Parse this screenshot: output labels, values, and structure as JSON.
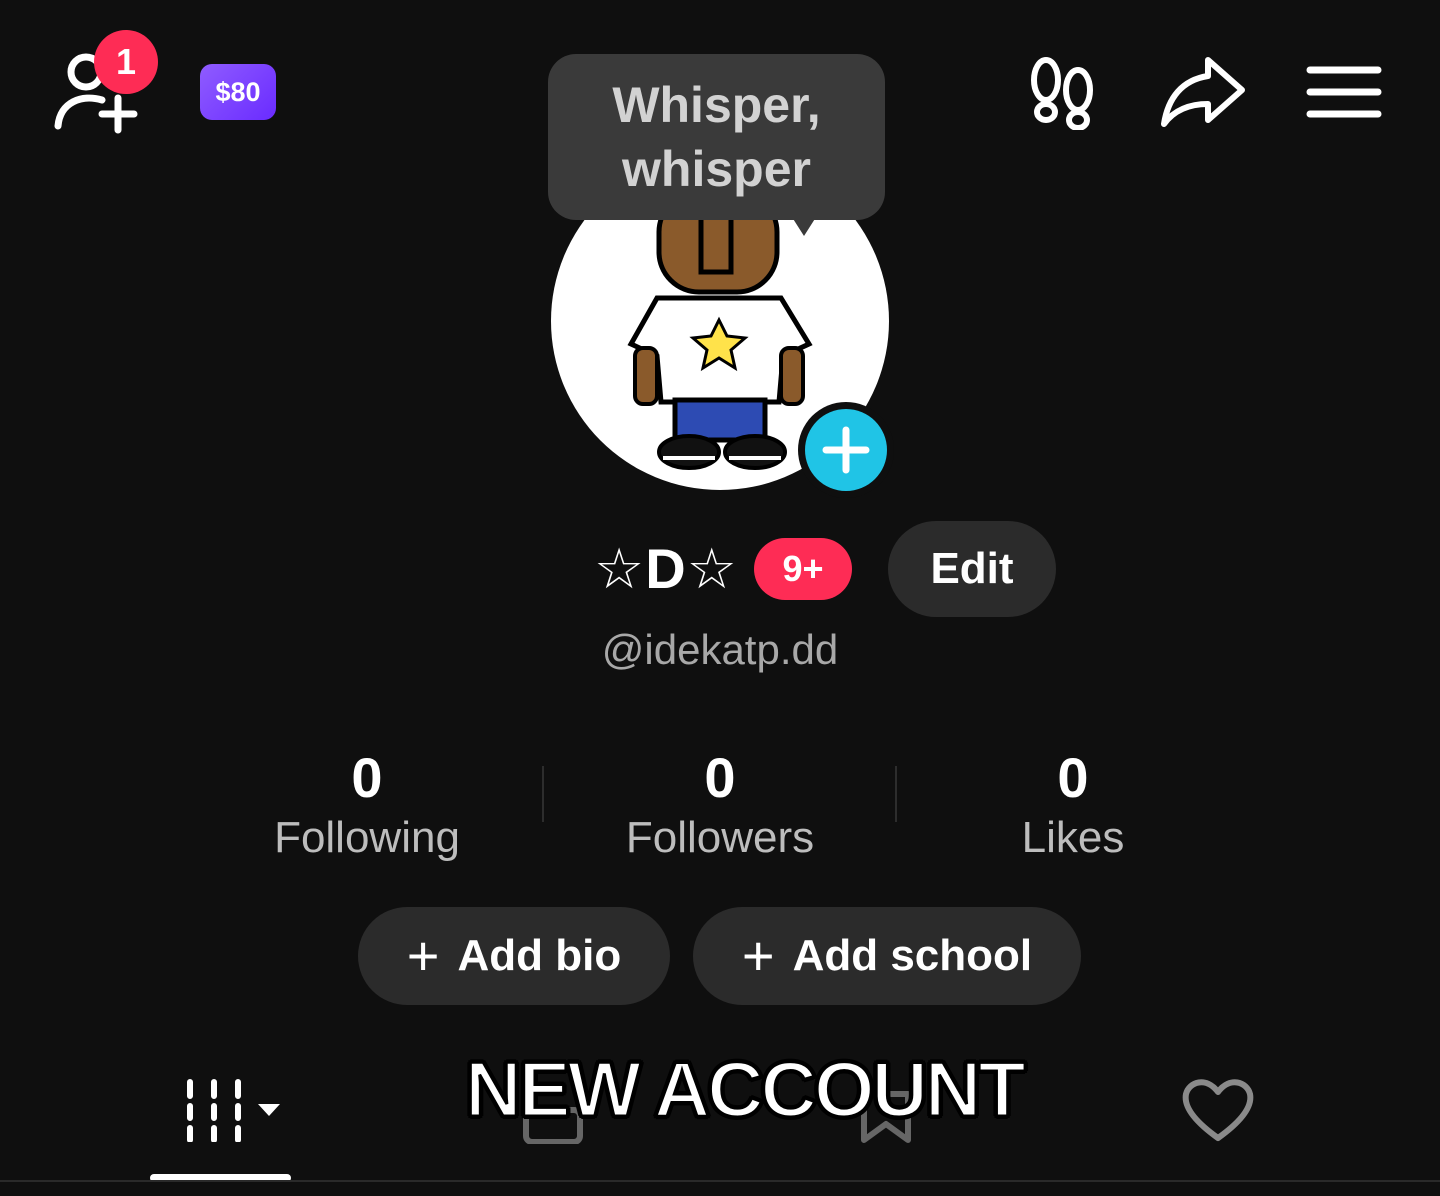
{
  "header": {
    "notification_count": "1",
    "coins_label": "$80"
  },
  "whisper_bubble": {
    "line1": "Whisper,",
    "line2": "whisper"
  },
  "profile": {
    "display_name": "☆D☆",
    "name_badge": "9+",
    "edit_label": "Edit",
    "handle": "@idekatp.dd"
  },
  "stats": [
    {
      "value": "0",
      "label": "Following"
    },
    {
      "value": "0",
      "label": "Followers"
    },
    {
      "value": "0",
      "label": "Likes"
    }
  ],
  "actions": {
    "add_bio": "Add bio",
    "add_school": "Add school",
    "plus": "+"
  },
  "overlay_caption": "NEW ACCOUNT",
  "colors": {
    "background": "#0f0f0f",
    "accent_red": "#fe2c55",
    "accent_cyan": "#20c4e6",
    "coin_purple": "#7b3fff"
  },
  "icons": {
    "add_friends": "add-friend-icon",
    "footprint": "footprint-icon",
    "share": "share-arrow-icon",
    "menu": "hamburger-menu-icon",
    "videos_tab": "grid-bars-icon",
    "private_tab": "lock-icon",
    "favorites_tab": "bookmark-icon",
    "liked_tab": "heart-icon"
  }
}
